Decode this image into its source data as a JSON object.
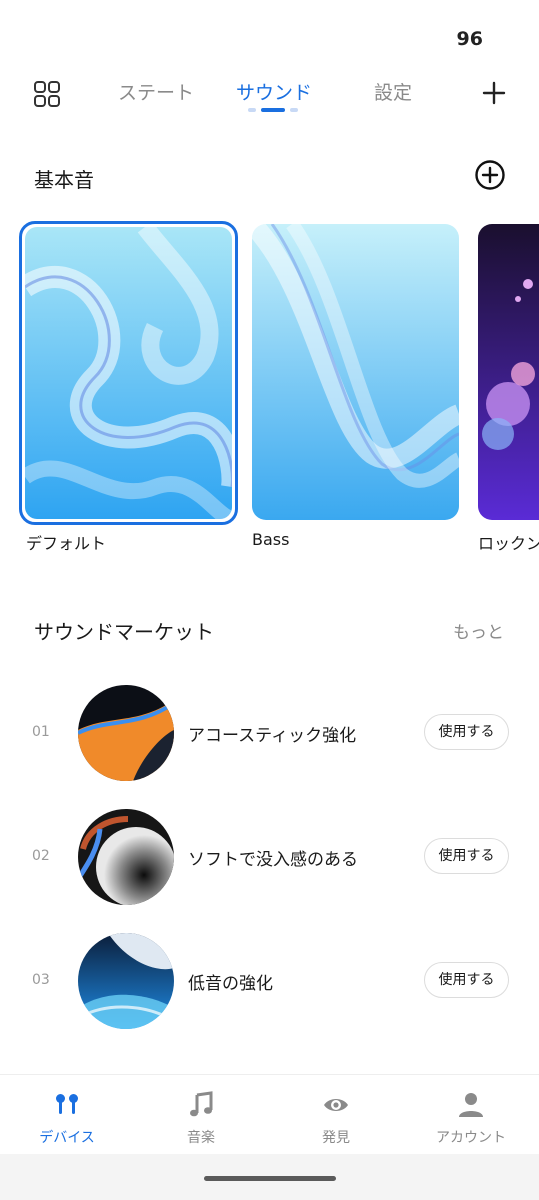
{
  "status_bar": {
    "battery": "96"
  },
  "top_nav": {
    "tabs": [
      {
        "label": "ステート",
        "active": false
      },
      {
        "label": "サウンド",
        "active": true
      },
      {
        "label": "設定",
        "active": false
      }
    ],
    "left_icon": "grid-icon",
    "right_icon": "plus-icon"
  },
  "basic_sounds": {
    "title": "基本音",
    "add_icon": "add-circle-icon",
    "cards": [
      {
        "label": "デフォルト",
        "selected": true
      },
      {
        "label": "Bass",
        "selected": false
      },
      {
        "label": "ロックン",
        "selected": false
      }
    ]
  },
  "market": {
    "title": "サウンドマーケット",
    "more": "もっと",
    "items": [
      {
        "num": "01",
        "title": "アコースティック強化",
        "button": "使用する"
      },
      {
        "num": "02",
        "title": "ソフトで没入感のある",
        "button": "使用する"
      },
      {
        "num": "03",
        "title": "低音の強化",
        "button": "使用する"
      }
    ]
  },
  "bottom_nav": {
    "items": [
      {
        "label": "デバイス",
        "icon": "earbuds-icon",
        "active": true
      },
      {
        "label": "音楽",
        "icon": "music-note-icon",
        "active": false
      },
      {
        "label": "発見",
        "icon": "eye-icon",
        "active": false
      },
      {
        "label": "アカウント",
        "icon": "person-icon",
        "active": false
      }
    ]
  },
  "colors": {
    "accent": "#1a6fe0",
    "muted": "#8a8a8a"
  }
}
